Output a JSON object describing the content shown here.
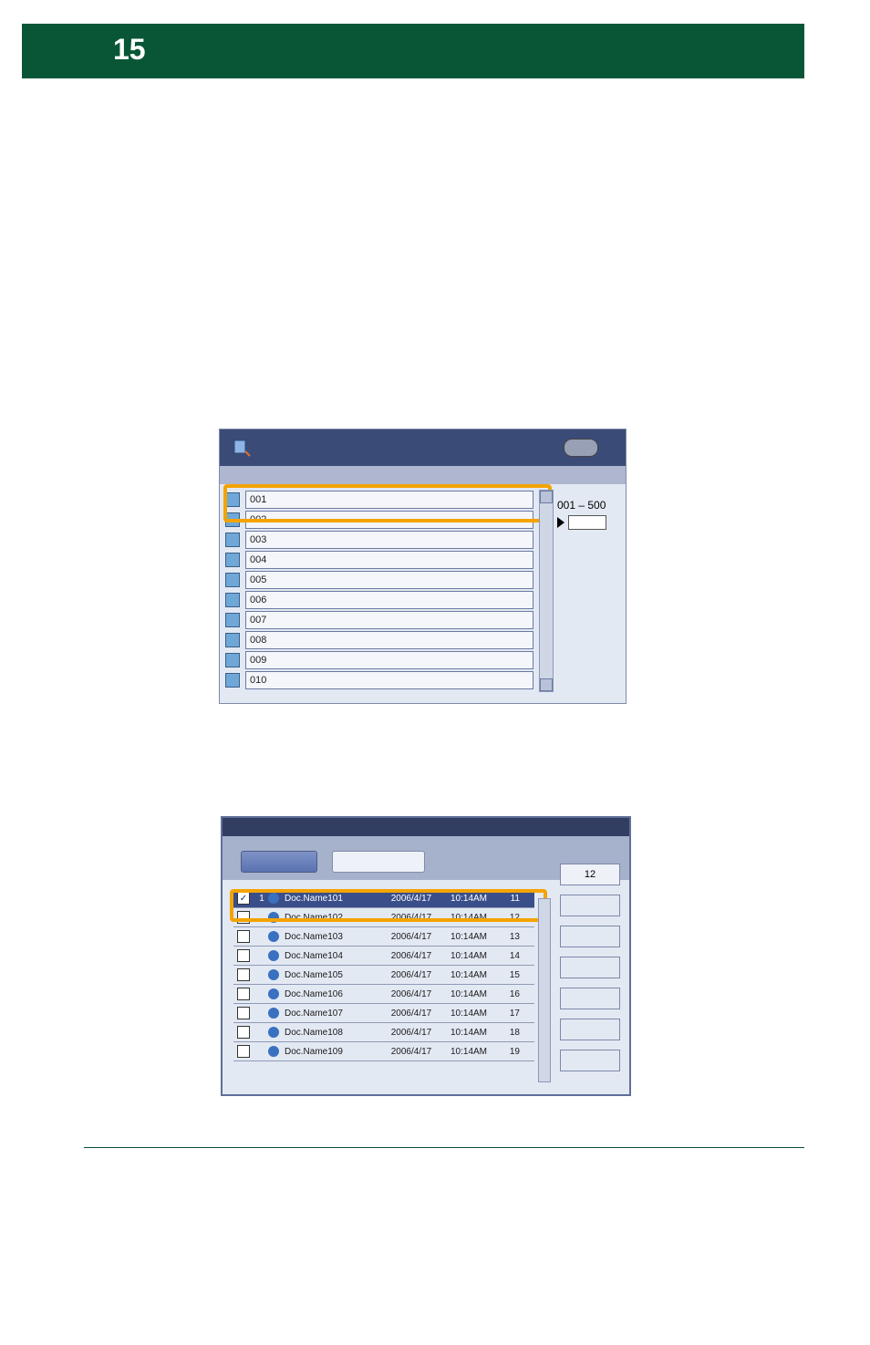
{
  "header": {
    "number": "15"
  },
  "shot1": {
    "rows": [
      "001",
      "002",
      "003",
      "004",
      "005",
      "006",
      "007",
      "008",
      "009",
      "010"
    ],
    "page_range": "001 – 500"
  },
  "shot2": {
    "side_count": "12",
    "rows": [
      {
        "ord": "1",
        "name": "Doc.Name101",
        "date": "2006/4/17",
        "time": "10:14AM",
        "sz": "11"
      },
      {
        "ord": "",
        "name": "Doc.Name102",
        "date": "2006/4/17",
        "time": "10:14AM",
        "sz": "12"
      },
      {
        "ord": "",
        "name": "Doc.Name103",
        "date": "2006/4/17",
        "time": "10:14AM",
        "sz": "13"
      },
      {
        "ord": "",
        "name": "Doc.Name104",
        "date": "2006/4/17",
        "time": "10:14AM",
        "sz": "14"
      },
      {
        "ord": "",
        "name": "Doc.Name105",
        "date": "2006/4/17",
        "time": "10:14AM",
        "sz": "15"
      },
      {
        "ord": "",
        "name": "Doc.Name106",
        "date": "2006/4/17",
        "time": "10:14AM",
        "sz": "16"
      },
      {
        "ord": "",
        "name": "Doc.Name107",
        "date": "2006/4/17",
        "time": "10:14AM",
        "sz": "17"
      },
      {
        "ord": "",
        "name": "Doc.Name108",
        "date": "2006/4/17",
        "time": "10:14AM",
        "sz": "18"
      },
      {
        "ord": "",
        "name": "Doc.Name109",
        "date": "2006/4/17",
        "time": "10:14AM",
        "sz": "19"
      }
    ]
  }
}
